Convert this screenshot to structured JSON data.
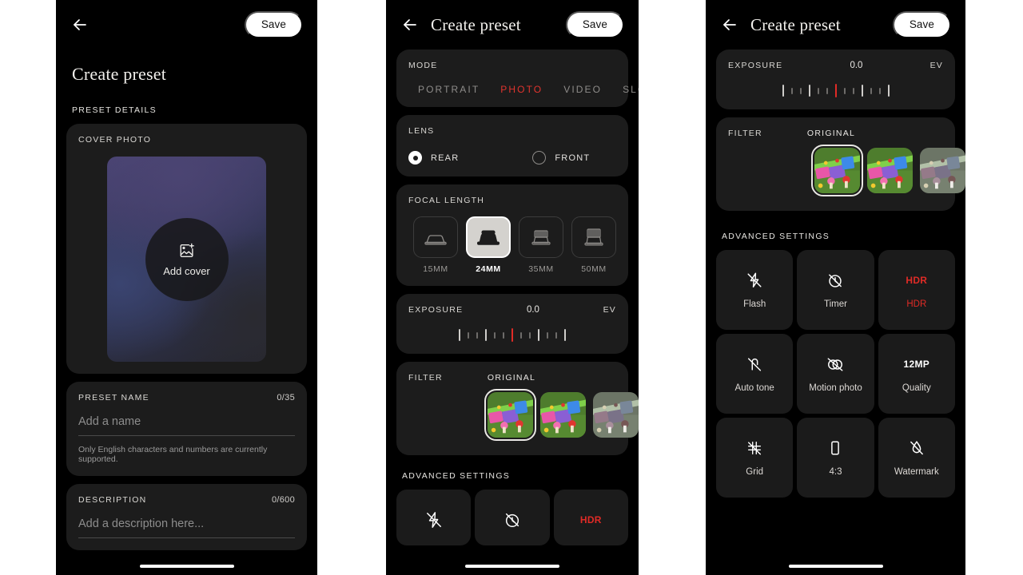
{
  "app": {
    "title": "Create preset",
    "save_label": "Save",
    "back_icon": "arrow-left-icon"
  },
  "panel1": {
    "page_title": "Create preset",
    "section_label": "PRESET DETAILS",
    "cover": {
      "label": "COVER PHOTO",
      "button_label": "Add cover",
      "button_icon": "add-image-icon",
      "gradient_from": "#4a4474",
      "gradient_to": "#26262e"
    },
    "preset_name": {
      "label": "PRESET NAME",
      "counter": "0/35",
      "placeholder": "Add a name",
      "hint": "Only English characters and numbers are currently supported."
    },
    "description": {
      "label": "DESCRIPTION",
      "counter": "0/600",
      "placeholder": "Add a description here..."
    }
  },
  "panel2": {
    "mode": {
      "label": "MODE",
      "options": [
        "PORTRAIT",
        "PHOTO",
        "VIDEO",
        "SLO-M"
      ],
      "selected": "PHOTO",
      "selected_color": "#e2342e"
    },
    "lens": {
      "label": "LENS",
      "options": [
        "REAR",
        "FRONT"
      ],
      "selected": "REAR"
    },
    "focal_length": {
      "label": "FOCAL LENGTH",
      "options": [
        "15MM",
        "24MM",
        "35MM",
        "50MM"
      ],
      "selected": "24MM"
    },
    "exposure": {
      "label": "EXPOSURE",
      "value": "0.0",
      "unit": "EV",
      "ticks": [
        "maj",
        "min",
        "min",
        "maj",
        "min",
        "min",
        "cur",
        "min",
        "min",
        "maj",
        "min",
        "min",
        "maj"
      ]
    },
    "filter": {
      "label": "FILTER",
      "selected_name": "ORIGINAL",
      "thumbnails": [
        "original",
        "vivid",
        "mono"
      ]
    },
    "advanced": {
      "label": "ADVANCED SETTINGS",
      "visible_items": [
        {
          "name": "Flash",
          "icon": "flash-off-icon",
          "state": "off"
        },
        {
          "name": "Timer",
          "icon": "timer-off-icon",
          "state": "off"
        },
        {
          "name": "HDR",
          "icon": "hdr-icon",
          "state": "on",
          "badge": "HDR"
        }
      ]
    }
  },
  "panel3": {
    "exposure": {
      "label": "EXPOSURE",
      "value": "0.0",
      "unit": "EV",
      "ticks": [
        "maj",
        "min",
        "min",
        "maj",
        "min",
        "min",
        "cur",
        "min",
        "min",
        "maj",
        "min",
        "min",
        "maj"
      ]
    },
    "filter": {
      "label": "FILTER",
      "selected_name": "ORIGINAL",
      "thumbnails": [
        "original",
        "vivid",
        "mono"
      ]
    },
    "advanced": {
      "label": "ADVANCED SETTINGS",
      "items": [
        {
          "name": "Flash",
          "icon": "flash-off-icon",
          "state": "off"
        },
        {
          "name": "Timer",
          "icon": "timer-off-icon",
          "state": "off"
        },
        {
          "name": "HDR",
          "icon": "hdr-icon",
          "state": "on",
          "badge": "HDR"
        },
        {
          "name": "Auto tone",
          "icon": "auto-tone-off-icon",
          "state": "off"
        },
        {
          "name": "Motion photo",
          "icon": "motion-photo-off-icon",
          "state": "off"
        },
        {
          "name": "Quality",
          "icon": "resolution-icon",
          "state": "off",
          "badge": "12MP"
        },
        {
          "name": "Grid",
          "icon": "grid-off-icon",
          "state": "off"
        },
        {
          "name": "4:3",
          "icon": "aspect-ratio-icon",
          "state": "off"
        },
        {
          "name": "Watermark",
          "icon": "watermark-off-icon",
          "state": "off"
        }
      ]
    }
  }
}
